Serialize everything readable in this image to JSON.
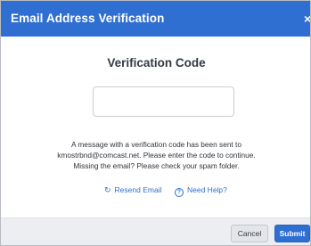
{
  "header": {
    "title": "Email Address Verification",
    "close_label": "×"
  },
  "main": {
    "title": "Verification Code",
    "code_input": {
      "value": "",
      "placeholder": ""
    },
    "message_lines": [
      "A message with a verification code has been sent to",
      "kmostrbnd@comcast.net. Please enter the code to continue.",
      "Missing the email? Please check your spam folder."
    ],
    "links": {
      "resend_label": "Resend Email",
      "resend_icon": "refresh-icon",
      "help_label": "Need Help?",
      "help_icon": "question-circle-icon"
    }
  },
  "footer": {
    "cancel_label": "Cancel",
    "submit_label": "Submit"
  },
  "colors": {
    "accent": "#2f6fd1",
    "footer_bg": "#eceef1"
  }
}
